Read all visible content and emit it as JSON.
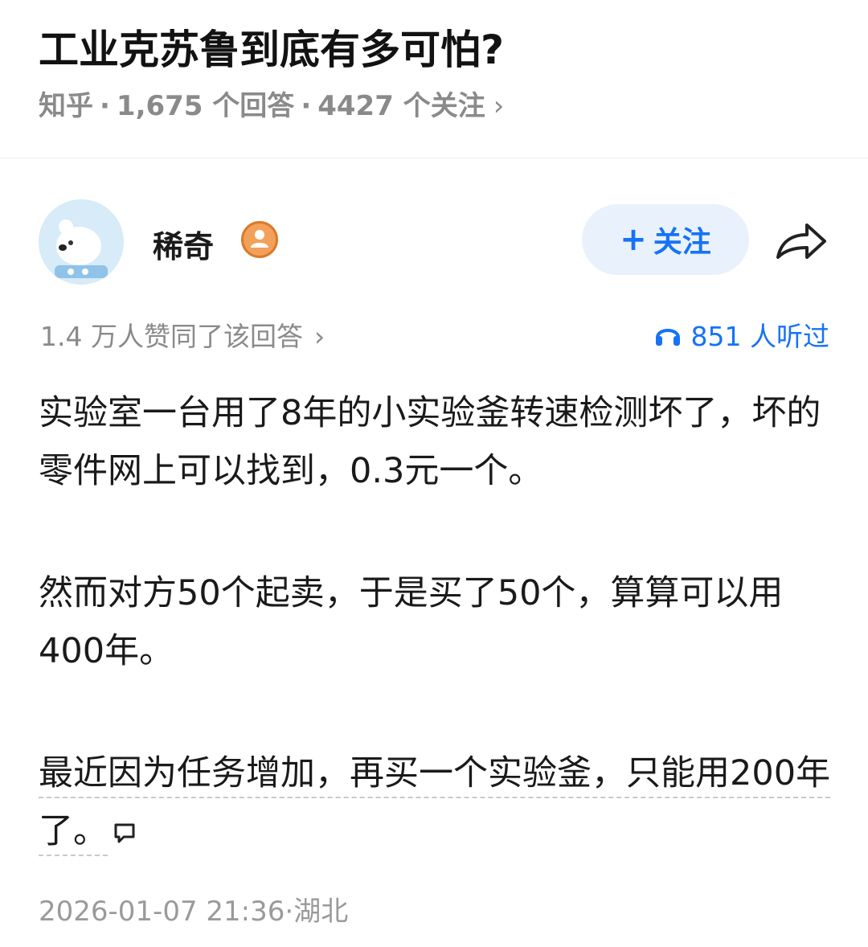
{
  "question": {
    "title": "工业克苏鲁到底有多可怕?",
    "source": "知乎",
    "answers_count": "1,675 个回答",
    "followers_count": "4427 个关注",
    "chevron": "›"
  },
  "author": {
    "name": "稀奇",
    "follow_label": "关注",
    "follow_prefix": "+",
    "avatar_icon": "bear-avatar-icon",
    "badge_icon": "user-badge-icon",
    "share_icon": "share-arrow-icon"
  },
  "stats": {
    "votes_text": "1.4 万人赞同了该回答",
    "chevron": "›",
    "listens_text": "851 人听过",
    "listens_icon": "headphones-icon"
  },
  "content": {
    "paragraphs": [
      "实验室一台用了8年的小实验釜转速检测坏了，坏的零件网上可以找到，0.3元一个。",
      "然而对方50个起卖，于是买了50个，算算可以用400年。",
      "最近因为任务增加，再买一个实验釜，只能用200年了。"
    ],
    "comment_icon": "comment-bubble-icon"
  },
  "footer": {
    "time_location": "2026-01-07 21:36·湖北"
  },
  "colors": {
    "accent": "#1772f6",
    "follow_bg": "#e9f2fc",
    "meta_gray": "#8a8a8a",
    "badge_orange": "#f3a15a"
  }
}
